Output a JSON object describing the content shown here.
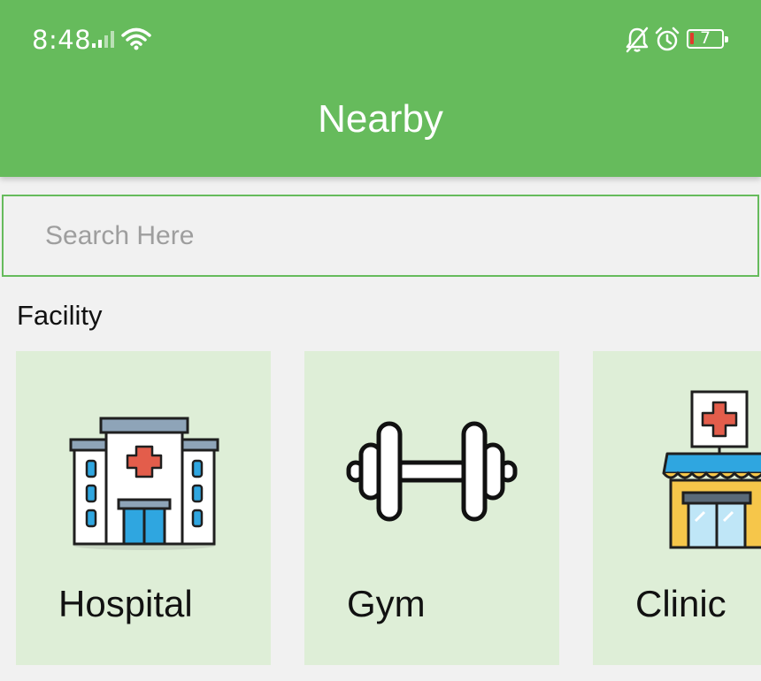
{
  "status_bar": {
    "time": "8:48",
    "battery_level": "7",
    "icons": [
      "signal-icon",
      "wifi-icon",
      "bell-off-icon",
      "alarm-icon",
      "battery-icon"
    ]
  },
  "header": {
    "title": "Nearby"
  },
  "search": {
    "placeholder": "Search Here"
  },
  "facility_section": {
    "title": "Facility",
    "items": [
      {
        "label": "Hospital",
        "icon": "hospital-icon"
      },
      {
        "label": "Gym",
        "icon": "dumbbell-icon"
      },
      {
        "label": "Clinic",
        "icon": "clinic-icon"
      }
    ]
  },
  "colors": {
    "primary": "#66bb5c",
    "card_background": "#deeed7",
    "page_background": "#f1f1f1",
    "text": "#111111",
    "placeholder": "#9e9e9e"
  }
}
